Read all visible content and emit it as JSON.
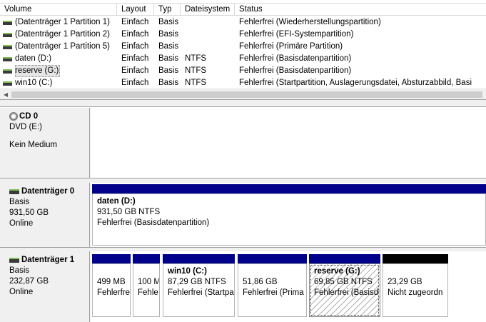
{
  "volume_list": {
    "columns": {
      "volume": "Volume",
      "layout": "Layout",
      "type": "Typ",
      "filesystem": "Dateisystem",
      "status": "Status"
    },
    "rows": [
      {
        "volume": "(Datenträger 1 Partition 1)",
        "layout": "Einfach",
        "type": "Basis",
        "filesystem": "",
        "status": "Fehlerfrei (Wiederherstellungspartition)"
      },
      {
        "volume": "(Datenträger 1 Partition 2)",
        "layout": "Einfach",
        "type": "Basis",
        "filesystem": "",
        "status": "Fehlerfrei (EFI-Systempartition)"
      },
      {
        "volume": "(Datenträger 1 Partition 5)",
        "layout": "Einfach",
        "type": "Basis",
        "filesystem": "",
        "status": "Fehlerfrei (Primäre Partition)"
      },
      {
        "volume": "daten (D:)",
        "layout": "Einfach",
        "type": "Basis",
        "filesystem": "NTFS",
        "status": "Fehlerfrei (Basisdatenpartition)"
      },
      {
        "volume": "reserve (G:)",
        "layout": "Einfach",
        "type": "Basis",
        "filesystem": "NTFS",
        "status": "Fehlerfrei (Basisdatenpartition)",
        "selected": true
      },
      {
        "volume": "win10 (C:)",
        "layout": "Einfach",
        "type": "Basis",
        "filesystem": "NTFS",
        "status": "Fehlerfrei (Startpartition, Auslagerungsdatei, Absturzabbild, Basi"
      }
    ]
  },
  "disks": {
    "cd0": {
      "title": "CD 0",
      "line1": "DVD (E:)",
      "line2": "Kein Medium"
    },
    "disk0": {
      "title": "Datenträger 0",
      "type": "Basis",
      "size": "931,50 GB",
      "state": "Online",
      "partitions": [
        {
          "name": "daten  (D:)",
          "size": "931,50 GB NTFS",
          "status": "Fehlerfrei (Basisdatenpartition)"
        }
      ]
    },
    "disk1": {
      "title": "Datenträger 1",
      "type": "Basis",
      "size": "232,87 GB",
      "state": "Online",
      "partitions": [
        {
          "name": "",
          "size": "499 MB",
          "status": "Fehlerfrei"
        },
        {
          "name": "",
          "size": "100 M",
          "status": "Fehle"
        },
        {
          "name": "win10  (C:)",
          "size": "87,29 GB NTFS",
          "status": "Fehlerfrei (Startpa"
        },
        {
          "name": "",
          "size": "51,86 GB",
          "status": "Fehlerfrei (Prima"
        },
        {
          "name": "reserve  (G:)",
          "size": "69,85 GB NTFS",
          "status": "Fehlerfrei (Basisd"
        },
        {
          "name": "",
          "size": "23,29 GB",
          "status": "Nicht zugeordn"
        }
      ]
    }
  },
  "colors": {
    "primary_partition_bar": "#00008b",
    "unallocated_bar": "#000000"
  }
}
